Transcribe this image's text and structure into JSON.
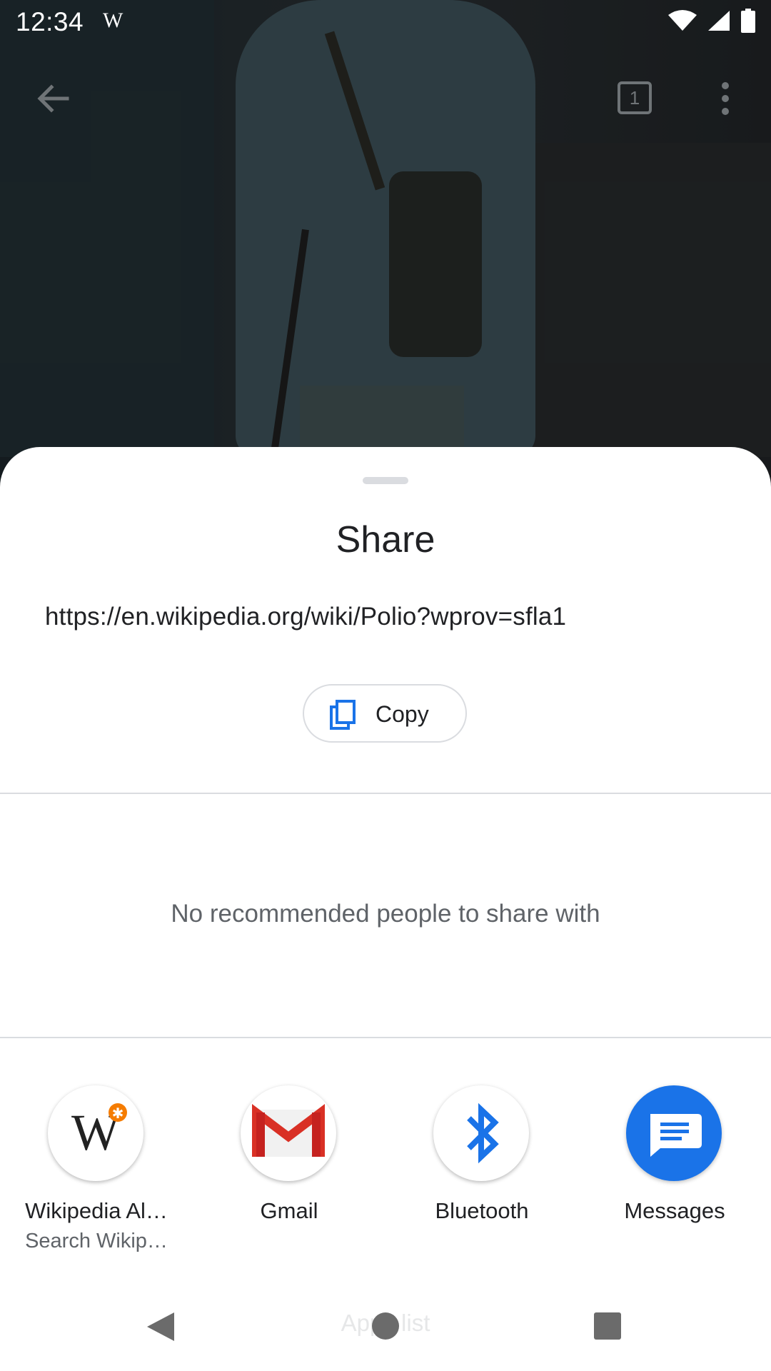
{
  "status_bar": {
    "time": "12:34",
    "app_logo": "W",
    "icons": [
      "wifi-icon",
      "signal-icon",
      "battery-icon"
    ]
  },
  "toolbar": {
    "tab_count": "1",
    "icons": [
      "back-arrow-icon",
      "tabs-icon",
      "more-vert-icon"
    ]
  },
  "share_sheet": {
    "title": "Share",
    "url": "https://en.wikipedia.org/wiki/Polio?wprov=sfla1",
    "copy_label": "Copy",
    "no_people_text": "No recommended people to share with",
    "apps": [
      {
        "label": "Wikipedia Al…",
        "sublabel": "Search Wikip…",
        "icon": "wikipedia-icon"
      },
      {
        "label": "Gmail",
        "sublabel": "",
        "icon": "gmail-icon"
      },
      {
        "label": "Bluetooth",
        "sublabel": "",
        "icon": "bluetooth-icon"
      },
      {
        "label": "Messages",
        "sublabel": "",
        "icon": "messages-icon"
      }
    ],
    "app_list_label": "Apps list"
  },
  "colors": {
    "accent_blue": "#1a73e8",
    "text_primary": "#202124",
    "text_secondary": "#5f6368",
    "divider": "#dadce0",
    "gmail_red": "#d93025"
  }
}
